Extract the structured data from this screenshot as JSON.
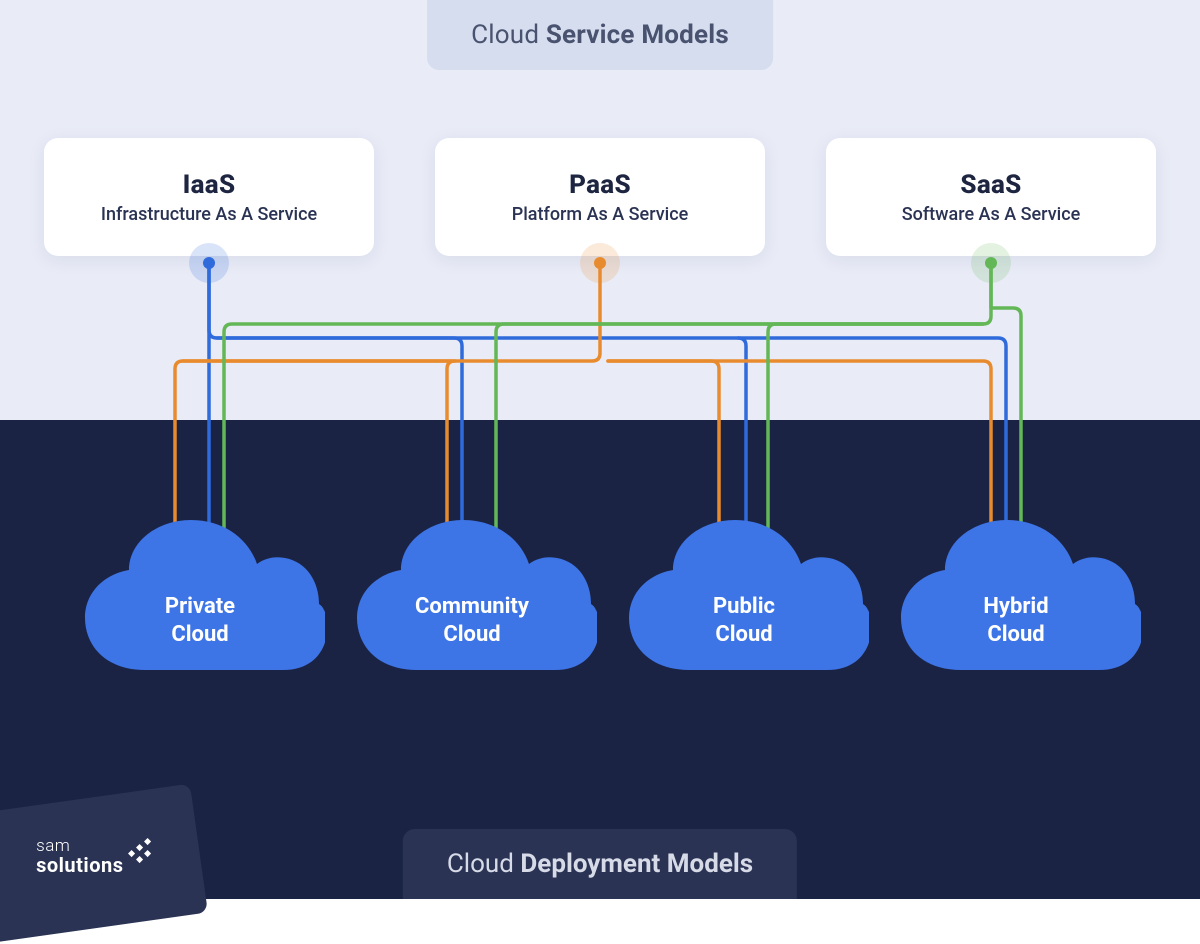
{
  "title_top": {
    "prefix": "Cloud ",
    "bold": "Service Models"
  },
  "title_bottom": {
    "prefix": "Cloud ",
    "bold": "Deployment Models"
  },
  "services": [
    {
      "acronym": "IaaS",
      "subtitle": "Infrastructure As A Service",
      "color": "#2f6bdb"
    },
    {
      "acronym": "PaaS",
      "subtitle": "Platform As A Service",
      "color": "#e88b2e"
    },
    {
      "acronym": "SaaS",
      "subtitle": "Software As A Service",
      "color": "#63b757"
    }
  ],
  "deployments": [
    {
      "label": "Private\nCloud"
    },
    {
      "label": "Community\nCloud"
    },
    {
      "label": "Public\nCloud"
    },
    {
      "label": "Hybrid\nCloud"
    }
  ],
  "logo": {
    "line1": "sam",
    "line2": "solutions"
  },
  "colors": {
    "cloud_fill": "#3d74e6",
    "bg_top": "#e9ecf7",
    "bg_bottom": "#1a2344"
  }
}
